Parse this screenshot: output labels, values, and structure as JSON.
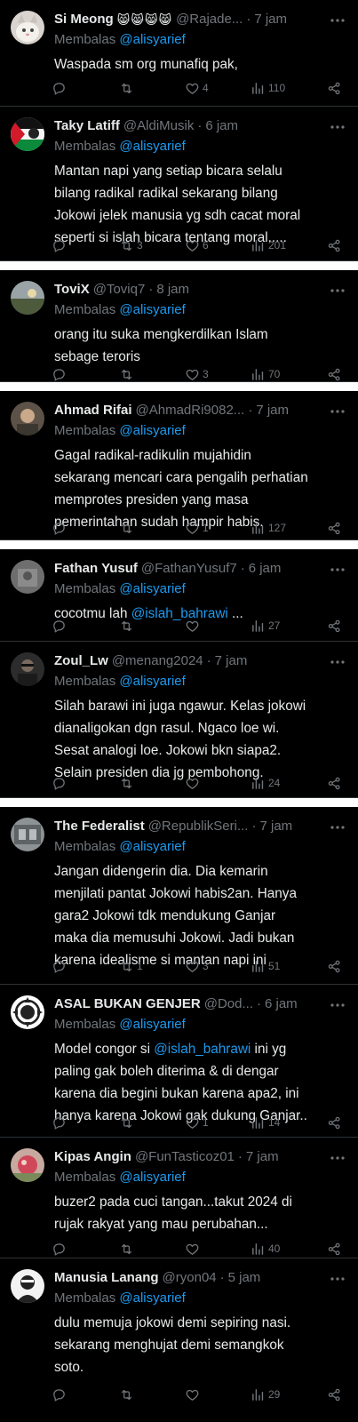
{
  "reply_prefix": "Membalas",
  "tweets": [
    {
      "name": "Si Meong",
      "emojis": "😸😸😸😸",
      "handle": "@Rajade...",
      "time": "7 jam",
      "reply_to": "@alisyarief",
      "text_lines": [
        "Waspada sm org munafiq pak,"
      ],
      "replies": "",
      "retweets": "",
      "likes": "4",
      "views": "110"
    },
    {
      "name": "Taky Latiff",
      "handle": "@AldiMusik",
      "time": "6 jam",
      "reply_to": "@alisyarief",
      "text_lines": [
        "Mantan napi yang setiap bicara selalu",
        "bilang radikal radikal sekarang bilang",
        "Jokowi jelek manusia yg sdh cacat moral",
        "seperti si islah bicara tentang moral....."
      ],
      "replies": "",
      "retweets": "3",
      "likes": "6",
      "views": "201"
    },
    {
      "name": "ToviX",
      "handle": "@Toviq7",
      "time": "8 jam",
      "reply_to": "@alisyarief",
      "text_lines": [
        "orang itu suka mengkerdilkan Islam",
        "sebage teroris"
      ],
      "replies": "",
      "retweets": "",
      "likes": "3",
      "views": "70"
    },
    {
      "name": "Ahmad Rifai",
      "handle": "@AhmadRi9082...",
      "time": "7 jam",
      "reply_to": "@alisyarief",
      "text_lines": [
        "Gagal radikal-radikulin mujahidin",
        "sekarang mencari cara pengalih perhatian",
        "memprotes presiden yang masa",
        "pemerintahan sudah hampir habis."
      ],
      "replies": "",
      "retweets": "",
      "likes": "1",
      "views": "127"
    },
    {
      "name": "Fathan Yusuf",
      "handle": "@FathanYusuf7",
      "time": "6 jam",
      "reply_to": "@alisyarief",
      "text_prefix": "cocotmu lah ",
      "text_link": "@islah_bahrawi",
      "text_suffix": " ...",
      "replies": "",
      "retweets": "",
      "likes": "",
      "views": "27"
    },
    {
      "name": "Zoul_Lw",
      "handle": "@menang2024",
      "time": "7 jam",
      "reply_to": "@alisyarief",
      "text_lines": [
        "Silah barawi ini juga ngawur. Kelas jokowi",
        "dianaligokan dgn rasul.  Ngaco loe wi.",
        "Sesat analogi loe. Jokowi bkn siapa2.",
        "Selain presiden dia jg pembohong."
      ],
      "replies": "",
      "retweets": "",
      "likes": "",
      "views": "24"
    },
    {
      "name": "The Federalist",
      "handle": "@RepublikSeri...",
      "time": "7 jam",
      "reply_to": "@alisyarief",
      "text_lines": [
        "Jangan didengerin dia. Dia kemarin",
        "menjilati pantat Jokowi habis2an. Hanya",
        "gara2 Jokowi tdk mendukung Ganjar",
        "maka dia memusuhi Jokowi. Jadi bukan",
        "karena idealisme si mantan napi ini"
      ],
      "replies": "",
      "retweets": "1",
      "likes": "3",
      "views": "51"
    },
    {
      "name": "ASAL BUKAN GENJER",
      "handle": "@Dod...",
      "time": "6 jam",
      "reply_to": "@alisyarief",
      "text_first_prefix": "Model congor si ",
      "text_link": "@islah_bahrawi",
      "text_first_suffix": " ini yg",
      "text_lines": [
        "paling gak boleh diterima & di dengar",
        "karena dia begini bukan karena apa2, ini",
        "hanya karena Jokowi gak dukung Ganjar.."
      ],
      "replies": "",
      "retweets": "",
      "likes": "1",
      "views": "14"
    },
    {
      "name": "Kipas Angin",
      "handle": "@FunTasticoz01",
      "time": "7 jam",
      "reply_to": "@alisyarief",
      "text_lines": [
        "buzer2 pada cuci tangan...takut 2024 di",
        "rujak rakyat yang mau perubahan..."
      ],
      "replies": "",
      "retweets": "",
      "likes": "",
      "views": "40"
    },
    {
      "name": "Manusia Lanang",
      "handle": "@ryon04",
      "time": "5 jam",
      "reply_to": "@alisyarief",
      "text_lines": [
        "dulu memuja jokowi demi sepiring nasi.",
        "sekarang menghujat demi semangkok",
        "soto."
      ],
      "replies": "",
      "retweets": "",
      "likes": "",
      "views": "29"
    }
  ]
}
